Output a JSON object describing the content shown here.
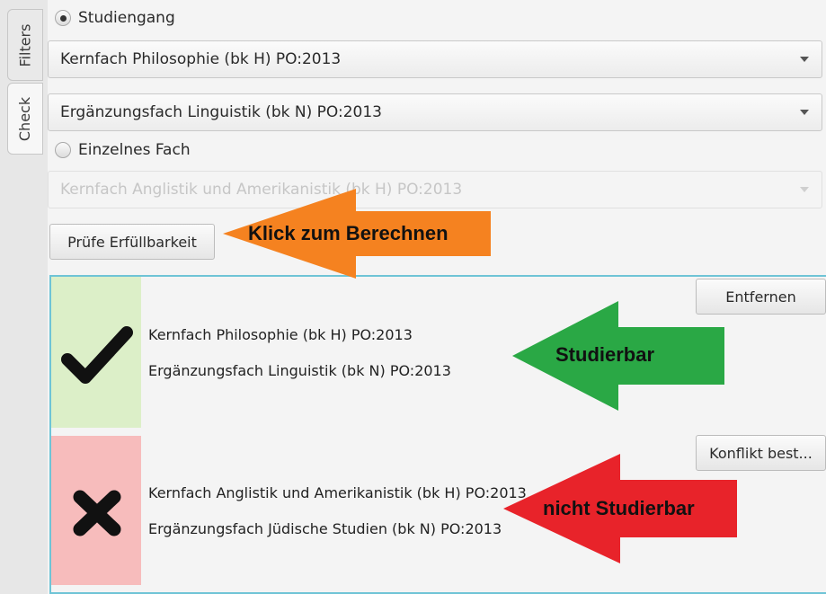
{
  "tabs": [
    {
      "label": "Filters"
    },
    {
      "label": "Check"
    }
  ],
  "studiengang": {
    "radio_label": "Studiengang",
    "selected": true,
    "combo1_value": "Kernfach Philosophie (bk H) PO:2013",
    "combo2_value": "Ergänzungsfach Linguistik (bk N) PO:2013"
  },
  "einzelnes_fach": {
    "radio_label": "Einzelnes Fach",
    "selected": false,
    "combo_value": "Kernfach Anglistik und Amerikanistik (bk H) PO:2013"
  },
  "check_button_label": "Prüfe Erfüllbarkeit",
  "results": [
    {
      "status": "ok",
      "status_color": "#dcefc8",
      "icon": "checkmark-icon",
      "lines": [
        "Kernfach Philosophie (bk H) PO:2013",
        "Ergänzungsfach Linguistik (bk N) PO:2013"
      ],
      "action_label": "Entfernen"
    },
    {
      "status": "conflict",
      "status_color": "#f7bcbc",
      "icon": "cross-icon",
      "lines": [
        "Kernfach Anglistik und Amerikanistik (bk H) PO:2013",
        "Ergänzungsfach Jüdische Studien (bk N) PO:2013"
      ],
      "action_label": "Konflikt best..."
    }
  ],
  "annotations": {
    "click": {
      "text": "Klick zum Berechnen",
      "color": "#f58220"
    },
    "ok": {
      "text": "Studierbar",
      "color": "#2aa845"
    },
    "bad": {
      "text": "nicht Studierbar",
      "color": "#e8232a"
    }
  }
}
